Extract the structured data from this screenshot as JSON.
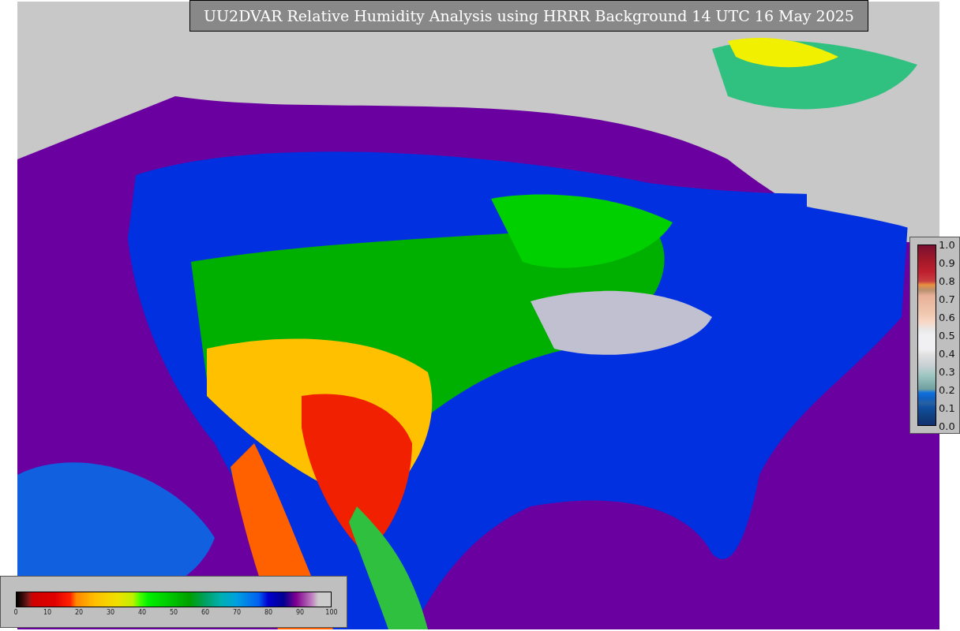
{
  "title": "UU2DVAR Relative Humidity Analysis using HRRR Background 14 UTC 16 May 2025",
  "bottom_colorbar": {
    "ticks": [
      "0",
      "10",
      "20",
      "30",
      "40",
      "50",
      "60",
      "70",
      "80",
      "90",
      "100"
    ]
  },
  "right_colorbar": {
    "ticks": [
      "1.0",
      "0.9",
      "0.8",
      "0.7",
      "0.6",
      "0.5",
      "0.4",
      "0.3",
      "0.2",
      "0.1",
      "0.0"
    ]
  }
}
